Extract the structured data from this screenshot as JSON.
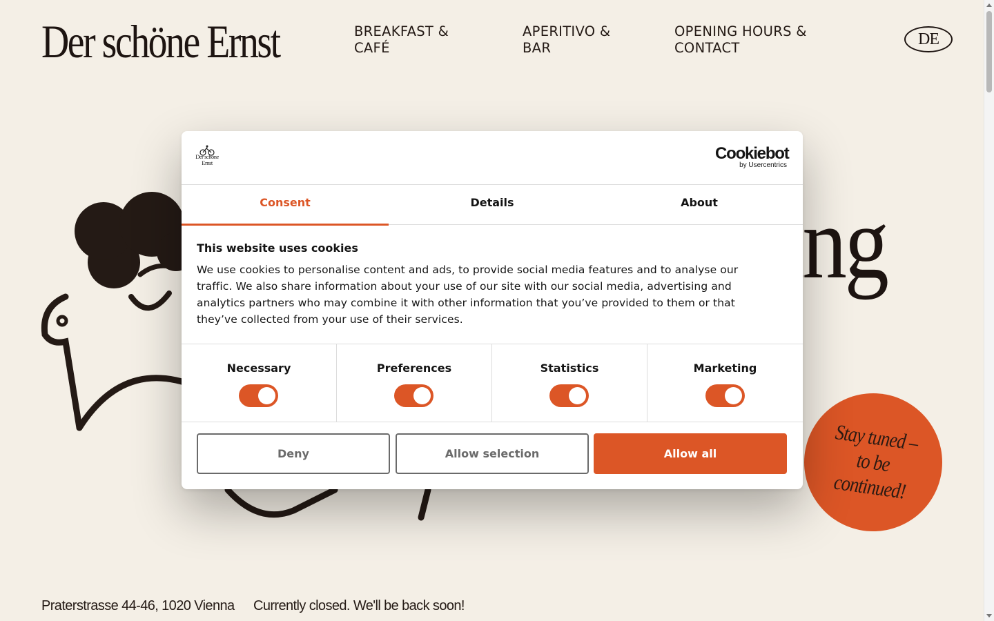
{
  "site": {
    "logo": "Der schöne Ernst",
    "nav": [
      {
        "label": "BREAKFAST & CAFÉ"
      },
      {
        "label": "APERITIVO & BAR"
      },
      {
        "label": "OPENING HOURS & CONTACT"
      }
    ],
    "language_button": "DE",
    "hero_partial_heading": "ing",
    "badge_text": "Stay tuned – to be continued!",
    "address": "Praterstrasse 44-46, 1020 Vienna",
    "status": "Currently closed. We'll be back soon!",
    "colors": {
      "background": "#f4efe6",
      "accent": "#dc5626",
      "ink": "#241a15"
    }
  },
  "cookie_dialog": {
    "mini_logo_text": "Der schöne Ernst",
    "brand_name": "Cookiebot",
    "brand_sub": "by Usercentrics",
    "tabs": [
      {
        "label": "Consent",
        "active": true
      },
      {
        "label": "Details",
        "active": false
      },
      {
        "label": "About",
        "active": false
      }
    ],
    "title": "This website uses cookies",
    "body": "We use cookies to personalise content and ads, to provide social media features and to analyse our traffic. We also share information about your use of our site with our social media, advertising and analytics partners who may combine it with other information that you’ve provided to them or that they’ve collected from your use of their services.",
    "toggles": [
      {
        "label": "Necessary",
        "on": true
      },
      {
        "label": "Preferences",
        "on": true
      },
      {
        "label": "Statistics",
        "on": true
      },
      {
        "label": "Marketing",
        "on": true
      }
    ],
    "buttons": {
      "deny": "Deny",
      "allow_selection": "Allow selection",
      "allow_all": "Allow all"
    }
  }
}
